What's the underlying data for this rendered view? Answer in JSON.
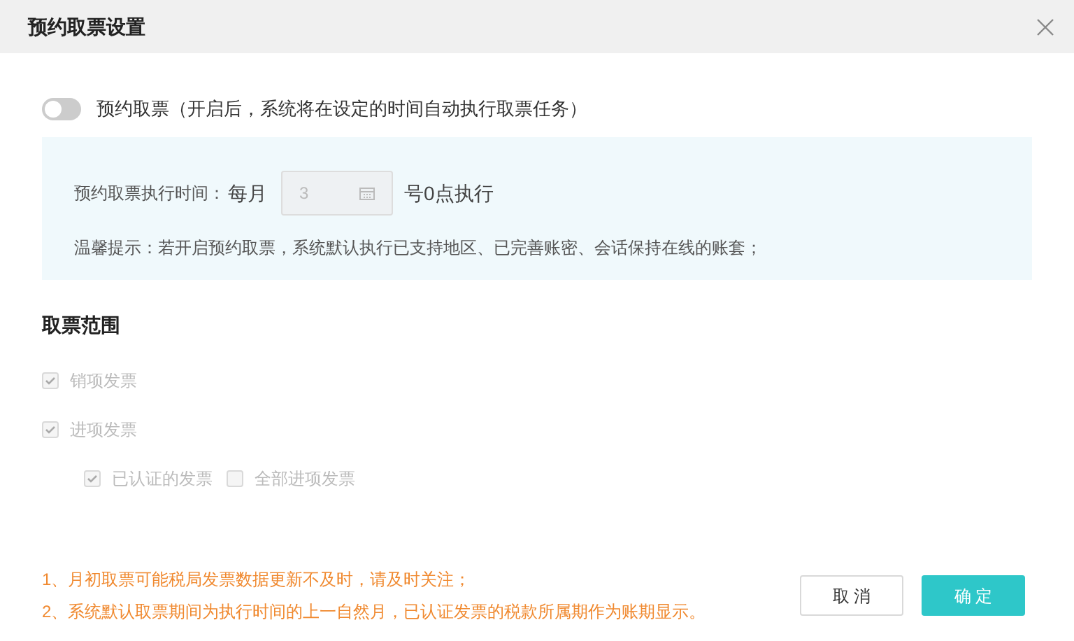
{
  "dialog": {
    "title": "预约取票设置"
  },
  "schedule_toggle": {
    "label": "预约取票（开启后，系统将在设定的时间自动执行取票任务）",
    "on": false
  },
  "schedule": {
    "label": "预约取票执行时间：",
    "prefix": "每月",
    "day_value": "3",
    "suffix": "号0点执行",
    "tip": "温馨提示：若开启预约取票，系统默认执行已支持地区、已完善账密、会话保持在线的账套；"
  },
  "scope": {
    "title": "取票范围",
    "items": [
      {
        "label": "销项发票",
        "checked": true,
        "disabled": true
      },
      {
        "label": "进项发票",
        "checked": true,
        "disabled": true,
        "children": [
          {
            "label": "已认证的发票",
            "checked": true,
            "disabled": true
          },
          {
            "label": "全部进项发票",
            "checked": false,
            "disabled": true
          }
        ]
      }
    ]
  },
  "notes": [
    "1、月初取票可能税局发票数据更新不及时，请及时关注；",
    "2、系统默认取票期间为执行时间的上一自然月，已认证发票的税款所属期作为账期显示。"
  ],
  "buttons": [
    {
      "label": "取 消",
      "kind": "secondary"
    },
    {
      "label": "确 定",
      "kind": "primary"
    }
  ]
}
